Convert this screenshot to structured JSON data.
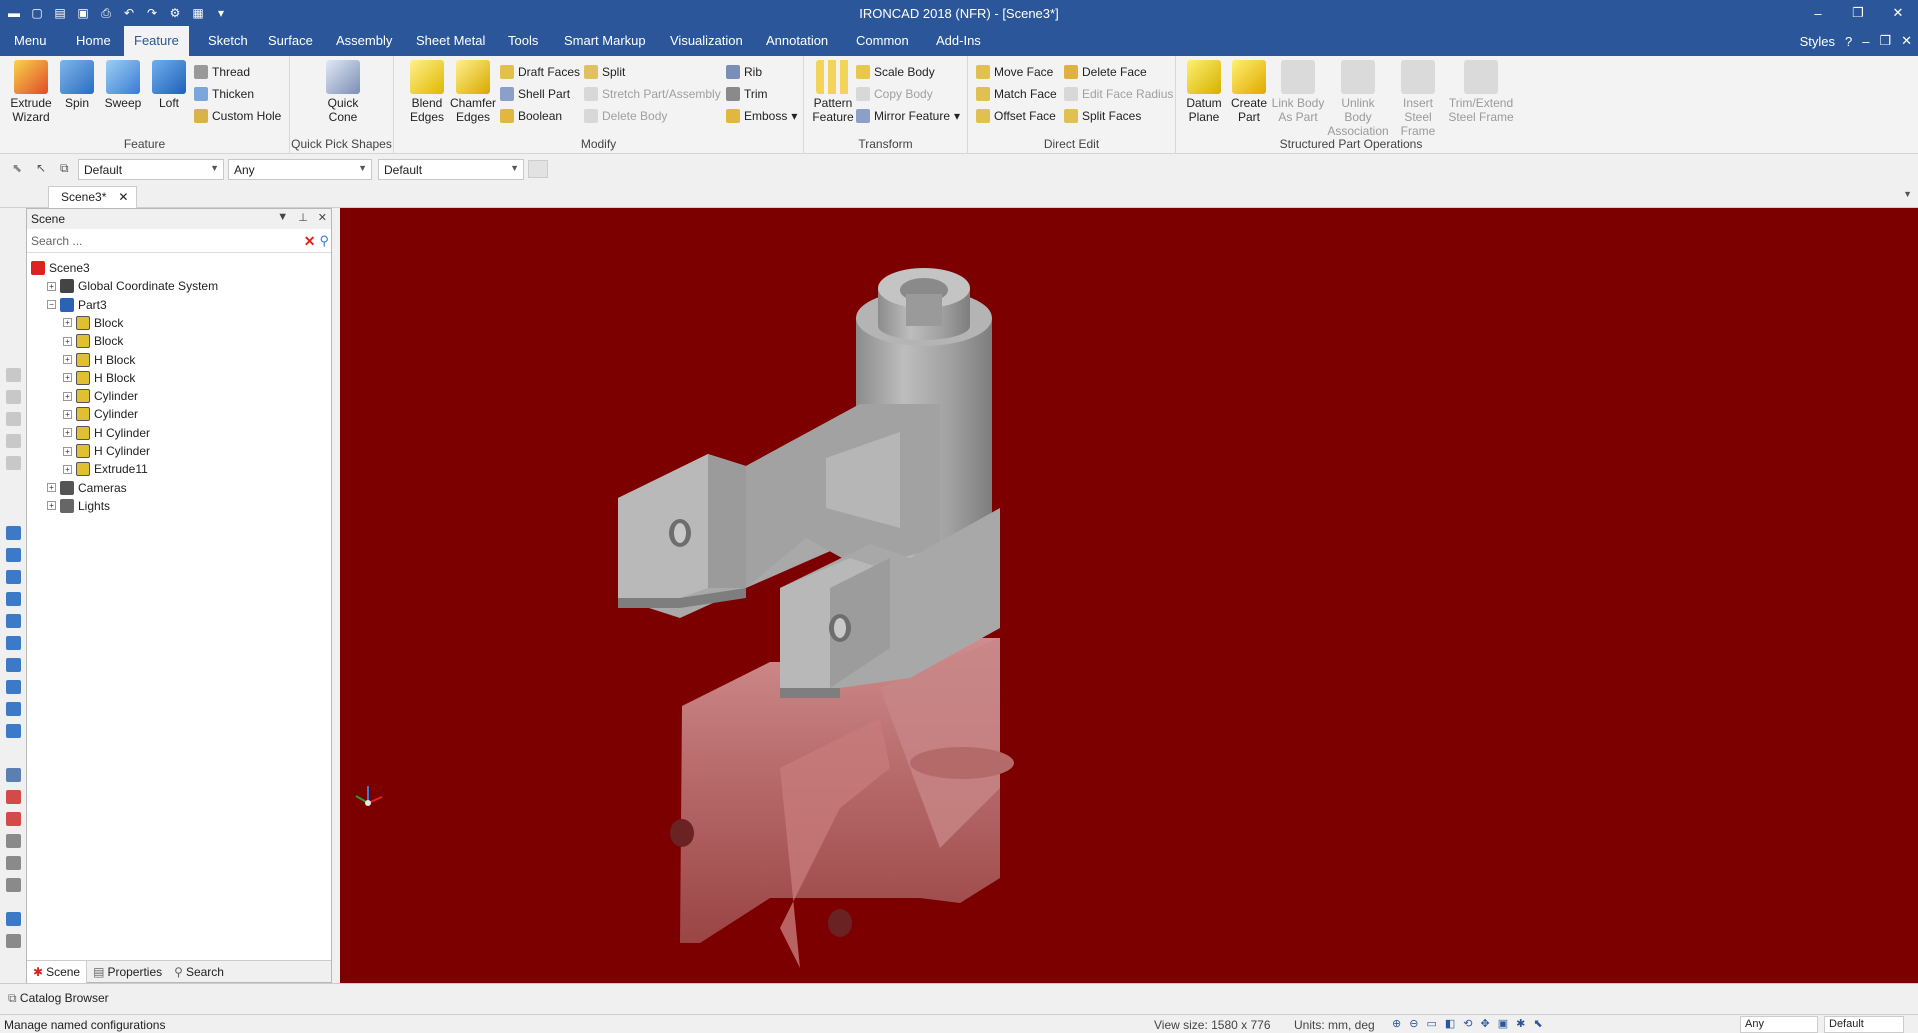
{
  "titlebar": {
    "title": "IRONCAD 2018 (NFR) - [Scene3*]",
    "qat_icons": [
      "app-icon",
      "new-icon",
      "open-icon",
      "save-icon",
      "print-icon",
      "undo-icon",
      "redo-icon"
    ],
    "controls": [
      "–",
      "❐",
      "✕"
    ]
  },
  "tabs": [
    {
      "label": "Menu"
    },
    {
      "label": "Home"
    },
    {
      "label": "Feature",
      "active": true
    },
    {
      "label": "Sketch"
    },
    {
      "label": "Surface"
    },
    {
      "label": "Assembly"
    },
    {
      "label": "Sheet Metal"
    },
    {
      "label": "Tools"
    },
    {
      "label": "Smart Markup"
    },
    {
      "label": "Visualization"
    },
    {
      "label": "Annotation"
    },
    {
      "label": "Common"
    },
    {
      "label": "Add-Ins"
    }
  ],
  "tabstrip_right": {
    "styles": "Styles",
    "help": "?"
  },
  "ribbon": {
    "feature": {
      "name": "Feature",
      "extrude": "Extrude Wizard",
      "spin": "Spin",
      "sweep": "Sweep",
      "loft": "Loft",
      "thread": "Thread",
      "thicken": "Thicken",
      "custom_hole": "Custom Hole"
    },
    "quick_pick": {
      "name": "Quick Pick Shapes",
      "quick_cone": "Quick Cone"
    },
    "modify": {
      "name": "Modify",
      "blend": "Blend Edges",
      "chamfer": "Chamfer Edges",
      "draft": "Draft Faces",
      "shell": "Shell Part",
      "boolean": "Boolean",
      "split": "Split",
      "stretch": "Stretch Part/Assembly",
      "delete_body": "Delete Body",
      "rib": "Rib",
      "trim": "Trim",
      "emboss": "Emboss"
    },
    "transform": {
      "name": "Transform",
      "pattern": "Pattern Feature",
      "scale": "Scale Body",
      "copy": "Copy Body",
      "mirror": "Mirror Feature"
    },
    "direct_edit": {
      "name": "Direct Edit",
      "move": "Move Face",
      "match": "Match Face",
      "offset": "Offset Face",
      "delete_face": "Delete Face",
      "edit_radius": "Edit Face Radius",
      "split_faces": "Split Faces"
    },
    "structured": {
      "name": "Structured Part Operations",
      "datum": "Datum Plane",
      "create_part": "Create Part",
      "link_body": "Link Body As Part",
      "unlink_body": "Unlink Body Association",
      "insert_steel": "Insert Steel Frame",
      "trim_steel": "Trim/Extend Steel Frame"
    }
  },
  "subbar": {
    "combo1": "Default",
    "combo2": "Any",
    "combo3": "Default"
  },
  "doc_tab": "Scene3*",
  "scene_panel": {
    "title": "Scene",
    "search_placeholder": "Search ...",
    "tree": [
      {
        "label": "Scene3",
        "level": 0,
        "icon": "scene-icon"
      },
      {
        "label": "Global Coordinate System",
        "level": 1,
        "icon": "axis-icon"
      },
      {
        "label": "Part3",
        "level": 1,
        "icon": "part-icon"
      },
      {
        "label": "Block",
        "level": 2,
        "icon": "feature-icon"
      },
      {
        "label": "Block",
        "level": 2,
        "icon": "feature-icon"
      },
      {
        "label": "H Block",
        "level": 2,
        "icon": "feature-icon"
      },
      {
        "label": "H Block",
        "level": 2,
        "icon": "feature-icon"
      },
      {
        "label": "Cylinder",
        "level": 2,
        "icon": "feature-icon"
      },
      {
        "label": "Cylinder",
        "level": 2,
        "icon": "feature-icon"
      },
      {
        "label": "H Cylinder",
        "level": 2,
        "icon": "feature-icon"
      },
      {
        "label": "H Cylinder",
        "level": 2,
        "icon": "feature-icon"
      },
      {
        "label": "Extrude11",
        "level": 2,
        "icon": "feature-icon"
      },
      {
        "label": "Cameras",
        "level": 1,
        "icon": "camera-icon"
      },
      {
        "label": "Lights",
        "level": 1,
        "icon": "light-icon"
      }
    ],
    "footer_tabs": [
      "Scene",
      "Properties",
      "Search"
    ]
  },
  "catalog_browser": "Catalog Browser",
  "status": {
    "message": "Manage named configurations",
    "view_size": "View size: 1580 x 776",
    "units": "Units: mm, deg",
    "combo1": "Any",
    "combo2": "Default"
  },
  "colors": {
    "viewport_bg": "#7c0000",
    "accent": "#2b579a",
    "part_gray": "#a6a6a6"
  }
}
